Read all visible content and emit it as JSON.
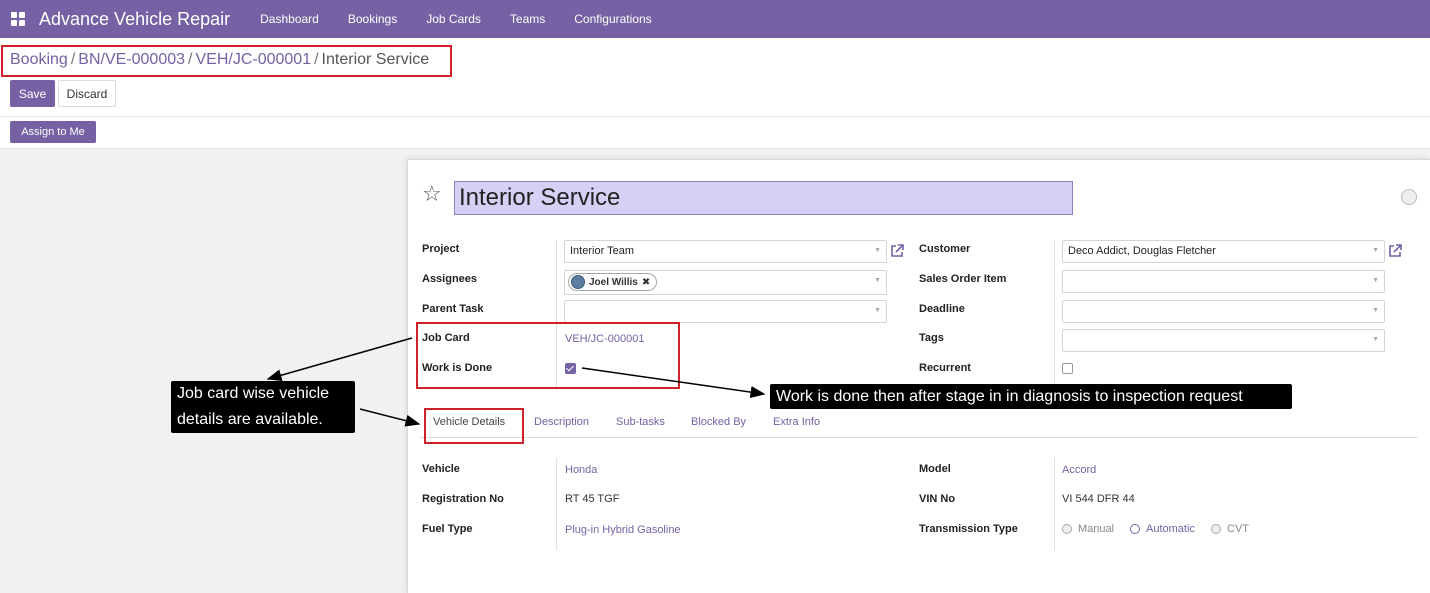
{
  "navbar": {
    "app_title": "Advance Vehicle Repair",
    "menu": [
      "Dashboard",
      "Bookings",
      "Job Cards",
      "Teams",
      "Configurations"
    ]
  },
  "breadcrumb": {
    "items": [
      "Booking",
      "BN/VE-000003",
      "VEH/JC-000001"
    ],
    "current": "Interior Service",
    "separator": "/"
  },
  "buttons": {
    "save": "Save",
    "discard": "Discard",
    "assign_to_me": "Assign to Me"
  },
  "record": {
    "title": "Interior Service",
    "left_fields": {
      "project_label": "Project",
      "project_value": "Interior Team",
      "assignees_label": "Assignees",
      "assignee_name": "Joel Willis",
      "parent_task_label": "Parent Task",
      "job_card_label": "Job Card",
      "job_card_value": "VEH/JC-000001",
      "work_done_label": "Work is Done"
    },
    "right_fields": {
      "customer_label": "Customer",
      "customer_value": "Deco Addict, Douglas Fletcher",
      "sales_order_label": "Sales Order Item",
      "deadline_label": "Deadline",
      "tags_label": "Tags",
      "recurrent_label": "Recurrent"
    }
  },
  "tabs": [
    "Vehicle Details",
    "Description",
    "Sub-tasks",
    "Blocked By",
    "Extra Info"
  ],
  "vehicle": {
    "vehicle_label": "Vehicle",
    "vehicle_value": "Honda",
    "reg_label": "Registration No",
    "reg_value": "RT 45 TGF",
    "fuel_label": "Fuel Type",
    "fuel_value": "Plug-in Hybrid Gasoline",
    "model_label": "Model",
    "model_value": "Accord",
    "vin_label": "VIN No",
    "vin_value": "VI 544 DFR 44",
    "transmission_label": "Transmission Type",
    "transmission_options": [
      "Manual",
      "Automatic",
      "CVT"
    ],
    "transmission_selected": "Automatic"
  },
  "callouts": {
    "job_card_line1": "Job card wise vehicle",
    "job_card_line2": "details are available.",
    "work_done": "Work is done then after stage in in diagnosis to inspection request"
  },
  "colors": {
    "brand": "#7561a3",
    "annotation_red": "#d0202a",
    "title_bg": "#d6d0f5"
  },
  "icons": [
    "apps-icon",
    "star-icon",
    "external-link-icon",
    "remove-tag-icon",
    "status-icon"
  ]
}
